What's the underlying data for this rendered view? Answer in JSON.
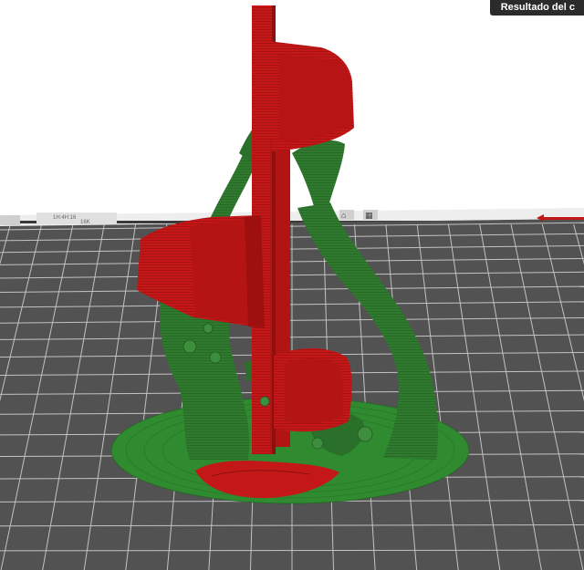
{
  "app": {
    "viewport": "layer-preview-3d"
  },
  "tooltip": {
    "text": "Resultado del c"
  },
  "printer_panel": {
    "lines": [
      "1H:4H:16",
      "16K"
    ]
  },
  "colors": {
    "background": "#ffffff",
    "build_plate": "#525252",
    "grid_line": "#cfcfcf",
    "plate_rim": "#eeeeee",
    "model": "#c41818",
    "support": "#2f7a2f",
    "tooltip_bg": "#2b2b2b"
  },
  "legend": {
    "model_color": "model",
    "support_color": "support"
  }
}
